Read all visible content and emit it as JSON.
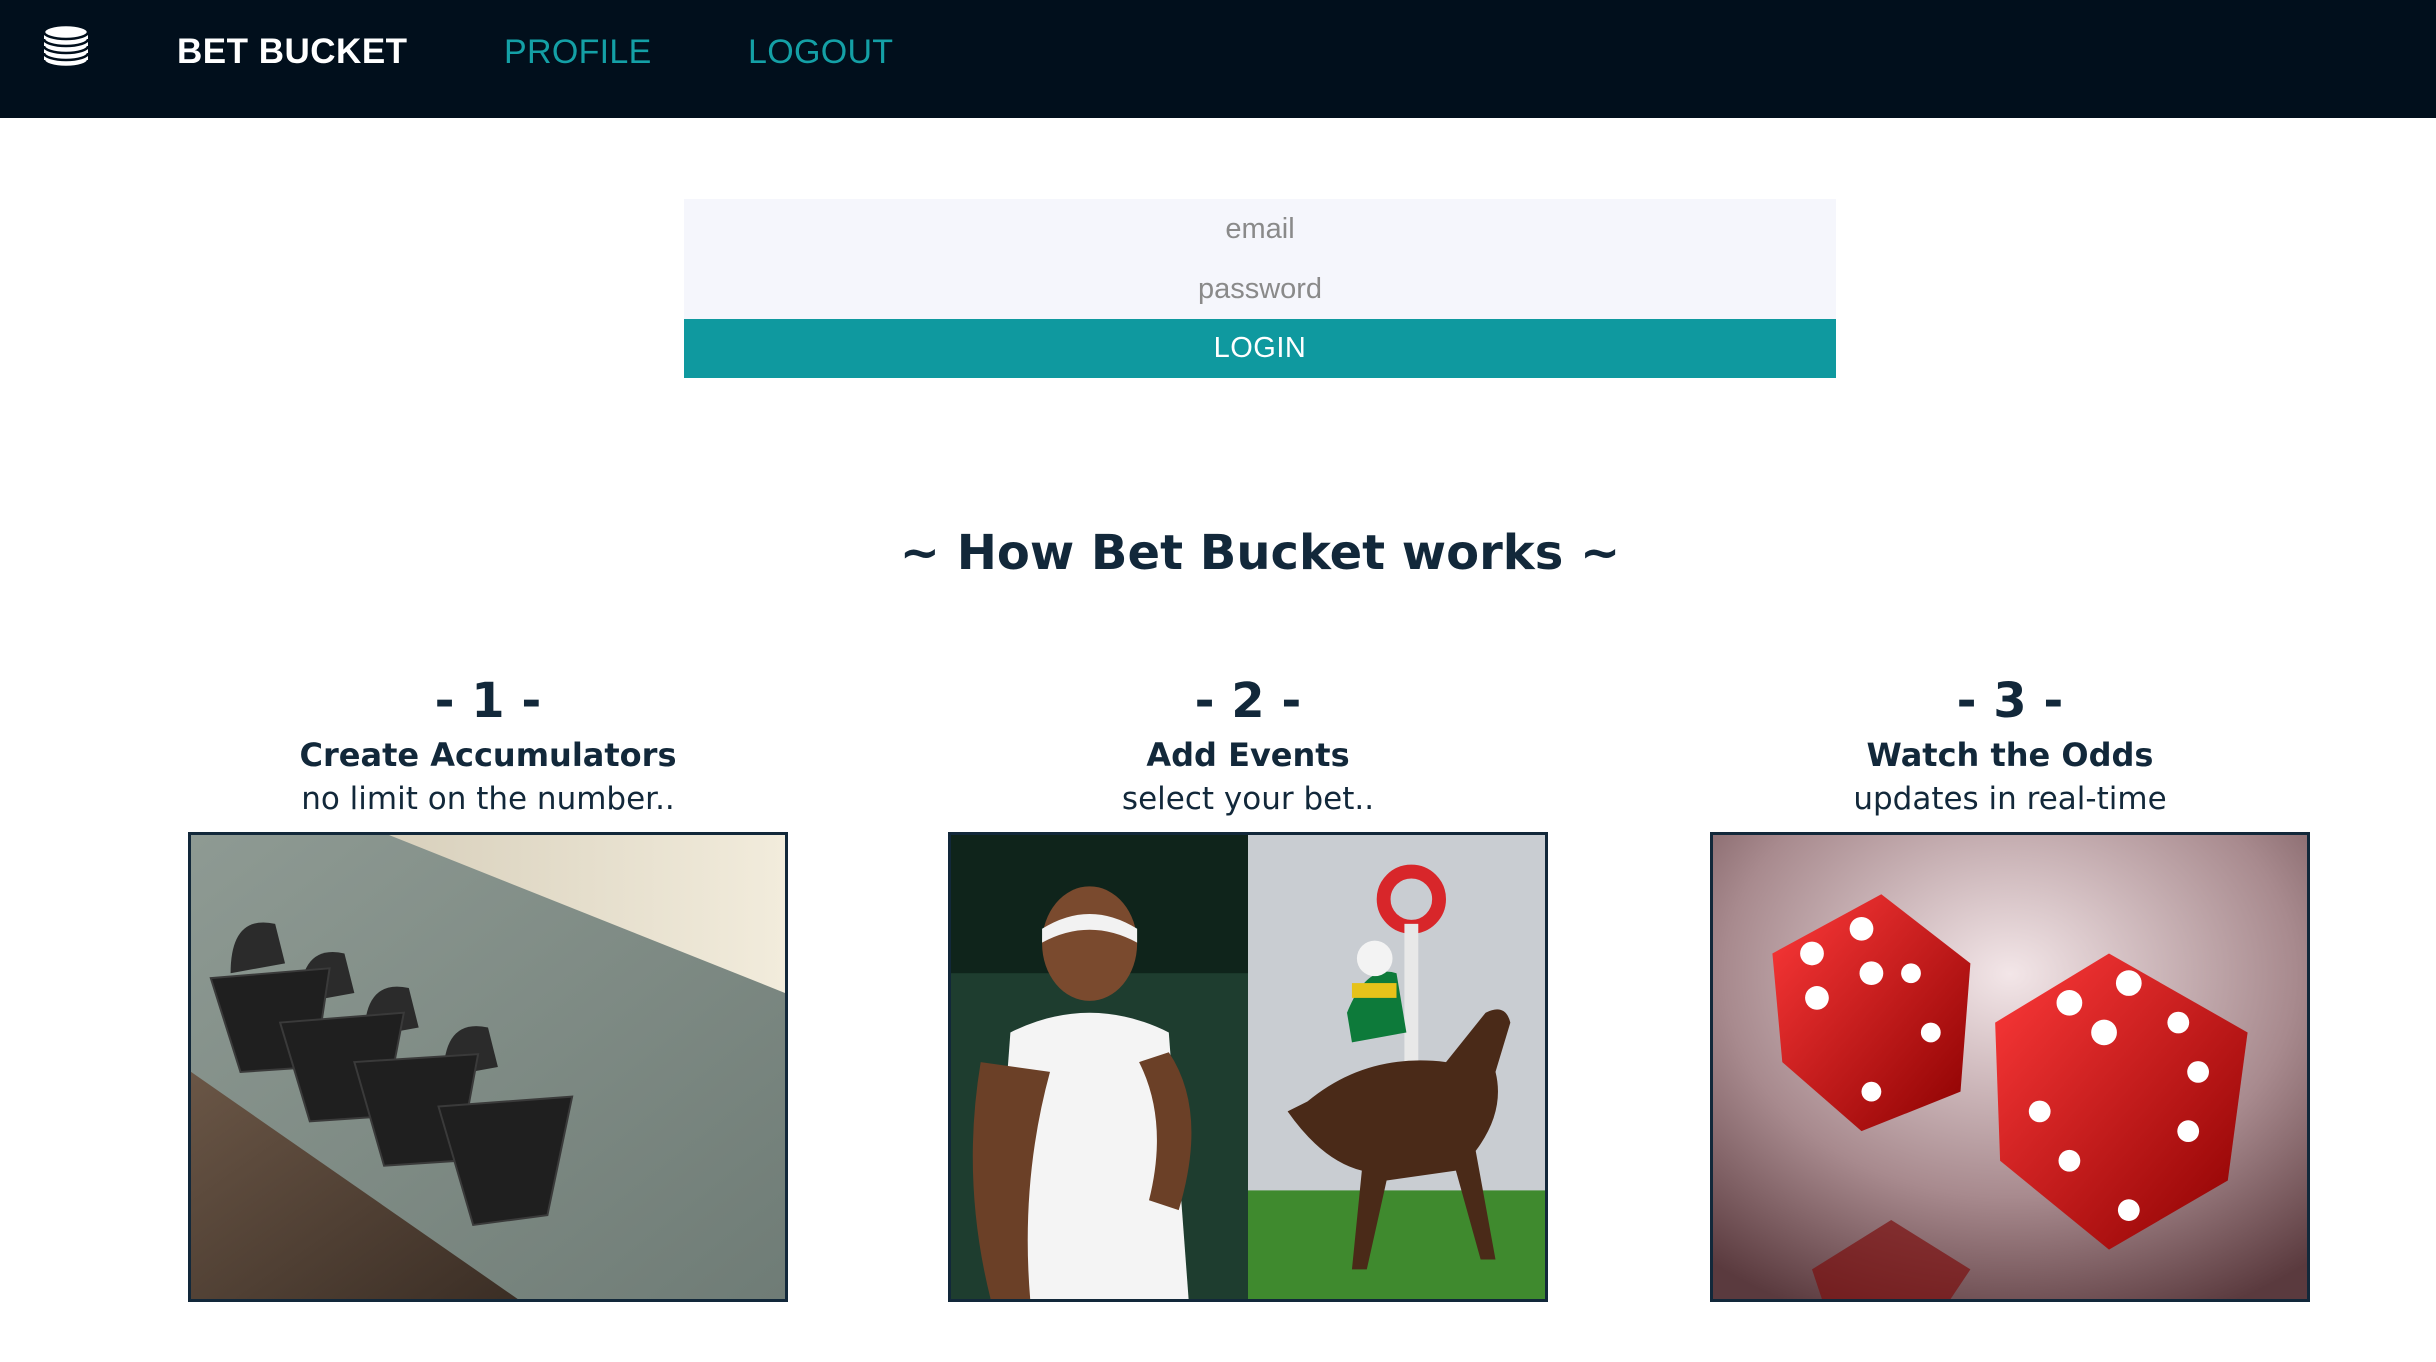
{
  "navbar": {
    "logo_icon": "coin-stack-icon",
    "brand": "BET BUCKET",
    "links": [
      {
        "label": "PROFILE"
      },
      {
        "label": "LOGOUT"
      }
    ],
    "background": "#010f1c",
    "link_color": "#14a0a6"
  },
  "login": {
    "email_placeholder": "email",
    "password_placeholder": "password",
    "button_label": "LOGIN",
    "button_color": "#0f999f",
    "input_background": "#f5f6fc"
  },
  "how_it_works": {
    "title": "~ How Bet Bucket works ~",
    "steps": [
      {
        "number": "- 1 -",
        "title": "Create Accumulators",
        "description": "no limit on the number..",
        "image": "hanging-buckets-photo"
      },
      {
        "number": "- 2 -",
        "title": "Add Events",
        "description": "select your bet..",
        "image": "tennis-and-horse-racing-photo"
      },
      {
        "number": "- 3 -",
        "title": "Watch the Odds",
        "description": "updates in real-time",
        "image": "red-dice-photo"
      }
    ]
  }
}
